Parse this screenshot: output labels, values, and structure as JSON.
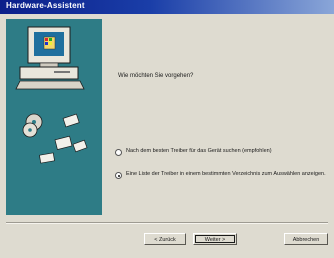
{
  "window": {
    "title": "Hardware-Assistent"
  },
  "main": {
    "question": "Wie möchten Sie vorgehen?",
    "options": [
      {
        "label": "Nach dem besten Treiber für das Gerät suchen (empfohlen)",
        "checked": false
      },
      {
        "label": "Eine Liste der Treiber in einem bestimmten Verzeichnis zum Auswählen anzeigen.",
        "checked": true
      }
    ]
  },
  "buttons": {
    "back": "< Zurück",
    "next": "Weiter >",
    "cancel": "Abbrechen"
  },
  "colors": {
    "titlebar": "#0b1f8a",
    "illustration_background": "#2e7c86"
  },
  "icons": [
    "computer-icon",
    "cd-disc-icon",
    "device-icon"
  ]
}
